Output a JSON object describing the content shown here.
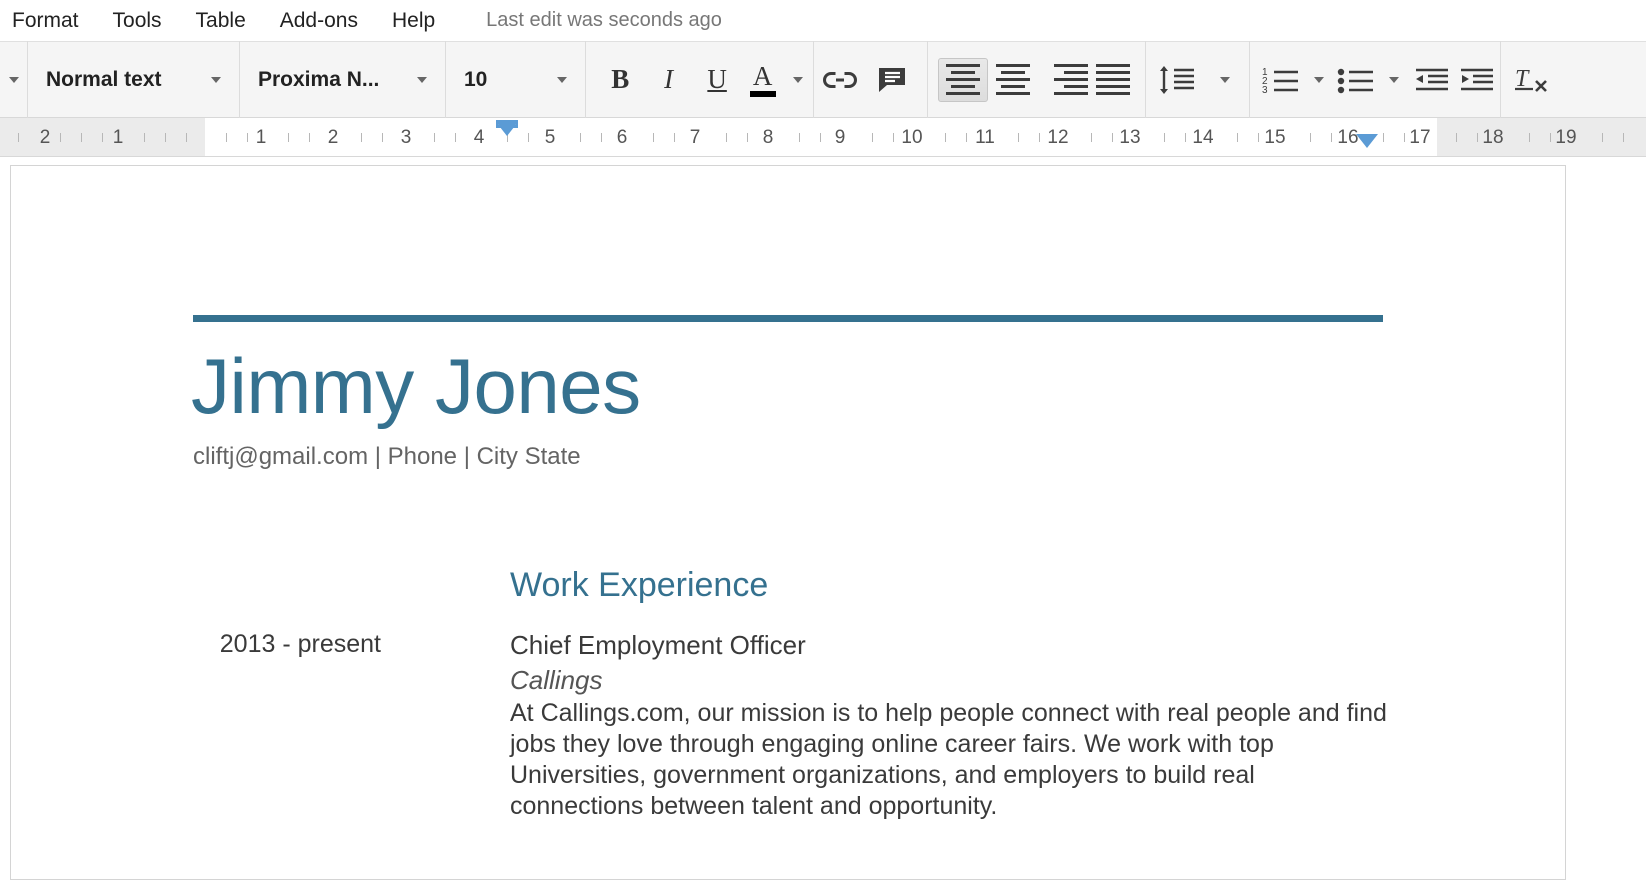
{
  "menu": {
    "items": [
      {
        "label": "Format",
        "name": "menu-format"
      },
      {
        "label": "Tools",
        "name": "menu-tools"
      },
      {
        "label": "Table",
        "name": "menu-table"
      },
      {
        "label": "Add-ons",
        "name": "menu-addons"
      },
      {
        "label": "Help",
        "name": "menu-help"
      }
    ],
    "last_edit": "Last edit was seconds ago"
  },
  "toolbar": {
    "style_value": "Normal text",
    "font_value": "Proxima N...",
    "font_size_value": "10",
    "bold_label": "B",
    "italic_label": "I",
    "underline_label": "U",
    "text_color_label": "A",
    "icons": {
      "undo_caret": "chevron-down-icon",
      "link": "link-icon",
      "comment": "add-comment-icon",
      "align_left": "align-left-icon",
      "align_center": "align-center-icon",
      "align_right": "align-right-icon",
      "align_justify": "align-justify-icon",
      "line_spacing": "line-spacing-icon",
      "numbered_list": "numbered-list-icon",
      "bulleted_list": "bulleted-list-icon",
      "decrease_indent": "decrease-indent-icon",
      "increase_indent": "increase-indent-icon",
      "clear_formatting": "clear-formatting-icon"
    },
    "colors": {
      "toolbar_bg": "#f5f5f5",
      "text_color_swatch": "#000000"
    }
  },
  "ruler": {
    "numbers": [
      "2",
      "1",
      "1",
      "2",
      "3",
      "4",
      "5",
      "6",
      "7",
      "8",
      "9",
      "10",
      "11",
      "12",
      "13",
      "14",
      "15",
      "16",
      "17",
      "18",
      "19"
    ],
    "left_indent_position": "4.5",
    "right_indent_position": "16.25"
  },
  "document": {
    "name": "Jimmy Jones",
    "contact": "cliftj@gmail.com | Phone | City State",
    "section_heading": "Work Experience",
    "entry": {
      "dates": "2013 - present",
      "title": "Chief Employment Officer",
      "company": "Callings",
      "description": "At Callings.com, our mission is to help people connect with real people and find jobs they love through engaging online career fairs. We work with top Universities, government organizations, and employers to build real connections between talent and opportunity."
    },
    "accent_color": "#35718f"
  }
}
